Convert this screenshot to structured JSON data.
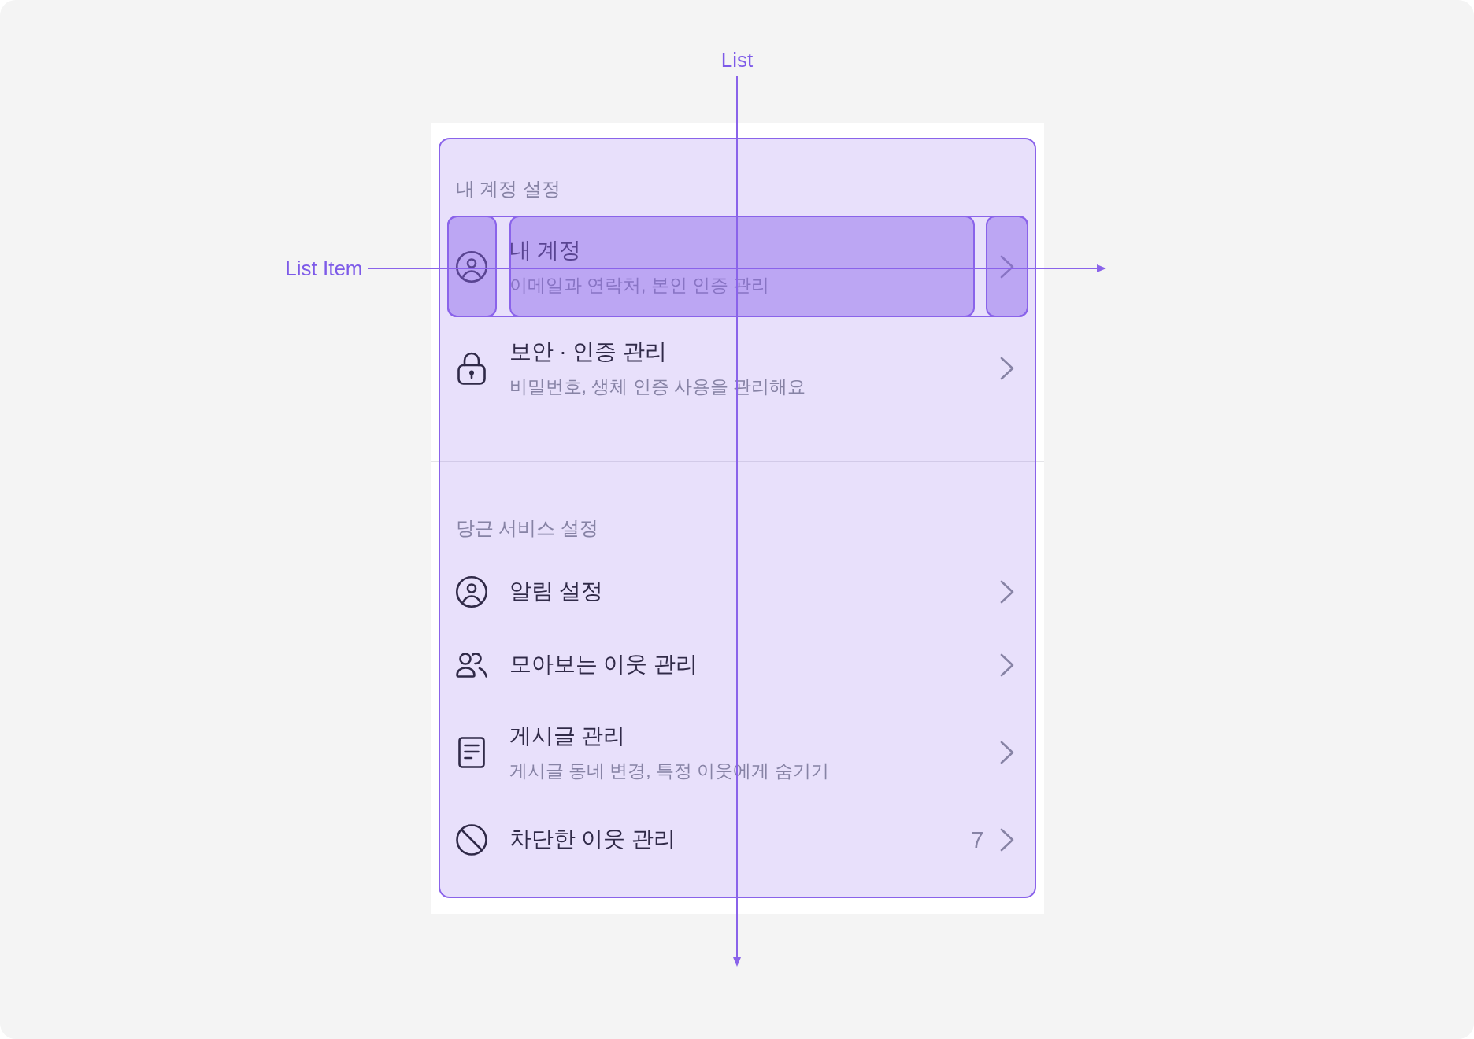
{
  "annotations": {
    "list": "List",
    "list_item": "List Item"
  },
  "sections": [
    {
      "header": "내 계정 설정",
      "items": [
        {
          "title": "내 계정",
          "description": "이메일과 연락처, 본인 인증 관리",
          "highlighted": true
        },
        {
          "title": "보안 · 인증 관리",
          "description": "비밀번호, 생체 인증 사용을 관리해요",
          "highlighted": false
        }
      ]
    },
    {
      "header": "당근 서비스 설정",
      "items": [
        {
          "title": "알림 설정",
          "highlighted": false
        },
        {
          "title": "모아보는 이웃 관리",
          "highlighted": false
        },
        {
          "title": "게시글 관리",
          "description": "게시글 동네 변경, 특정 이웃에게 숨기기",
          "highlighted": false
        },
        {
          "title": "차단한 이웃 관리",
          "count": "7",
          "highlighted": false
        }
      ]
    }
  ]
}
